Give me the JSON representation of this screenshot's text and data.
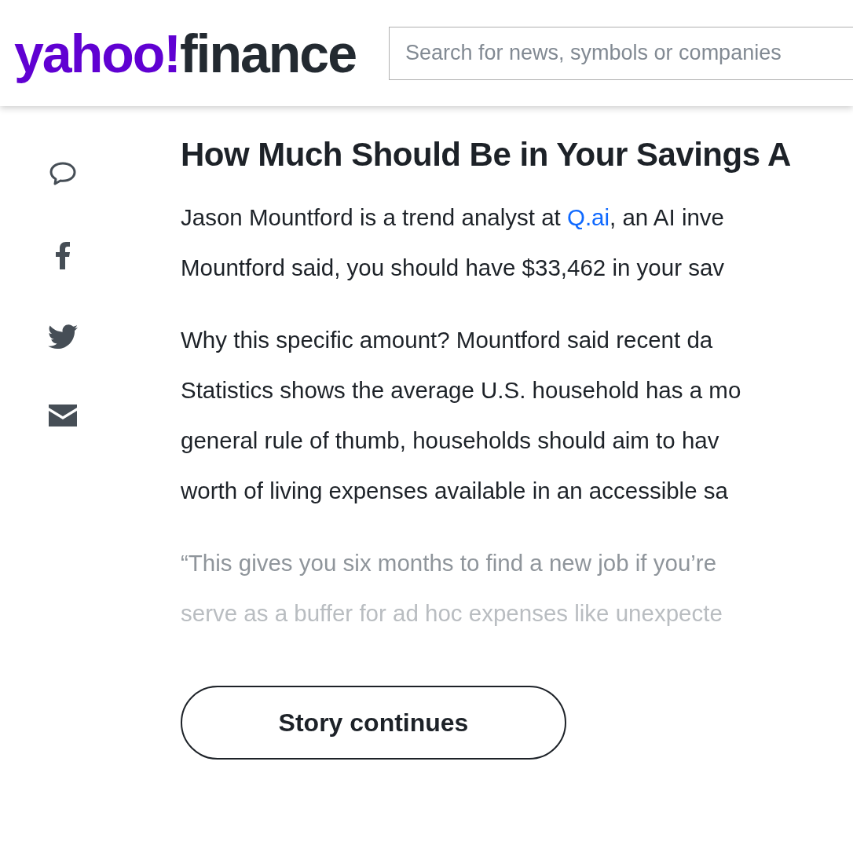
{
  "header": {
    "logo": {
      "brand": "yahoo!",
      "product": "finance"
    },
    "search": {
      "placeholder": "Search for news, symbols or companies"
    }
  },
  "share_icons": [
    {
      "kind": "comment"
    },
    {
      "kind": "facebook"
    },
    {
      "kind": "twitter"
    },
    {
      "kind": "mail"
    }
  ],
  "article": {
    "headline": "How Much Should Be in Your Savings A",
    "paragraphs": [
      {
        "kind": "body",
        "lines": [
          [
            {
              "text": "Jason Mountford is a trend analyst at "
            },
            {
              "text": "Q.ai",
              "link": true
            },
            {
              "text": ", an AI inve"
            }
          ],
          [
            {
              "text": "Mountford said, you should have $33,462 in your sav"
            }
          ]
        ]
      },
      {
        "kind": "body",
        "lines": [
          [
            {
              "text": "Why this specific amount? Mountford said recent da"
            }
          ],
          [
            {
              "text": "Statistics shows the average U.S. household has a mo"
            }
          ],
          [
            {
              "text": "general rule of thumb, households should aim to hav"
            }
          ],
          [
            {
              "text": "worth of living expenses available in an accessible sa"
            }
          ]
        ]
      },
      {
        "kind": "faded",
        "lines": [
          [
            {
              "text": "“This gives you six months to find a new job if you’re"
            }
          ],
          [
            {
              "text": "serve as a buffer for ad hoc expenses like unexpecte"
            }
          ]
        ]
      }
    ],
    "button": "Story continues"
  }
}
